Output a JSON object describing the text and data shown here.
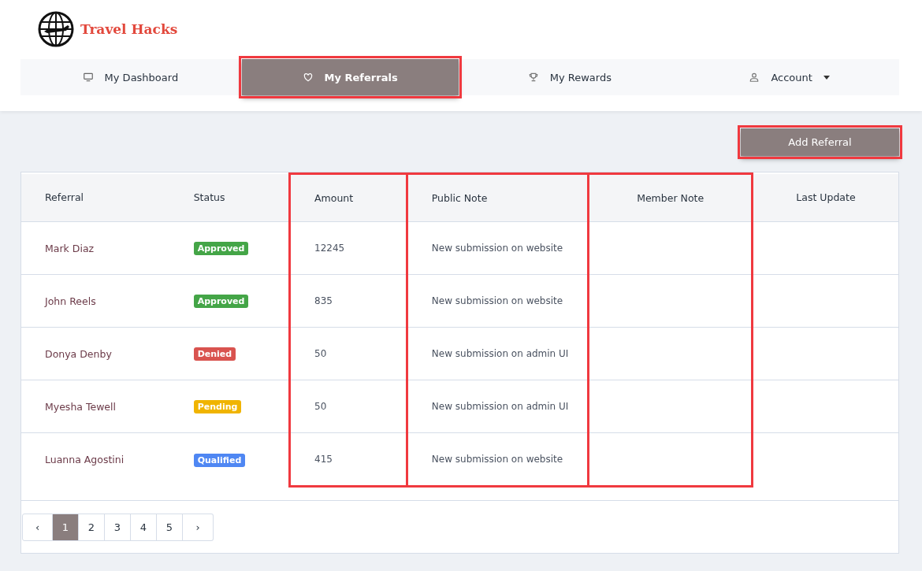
{
  "brand": {
    "name": "Travel Hacks"
  },
  "nav": [
    {
      "label": "My Dashboard",
      "selected": false,
      "highlighted": false
    },
    {
      "label": "My Referrals",
      "selected": true,
      "highlighted": true
    },
    {
      "label": "My Rewards",
      "selected": false,
      "highlighted": false
    },
    {
      "label": "Account",
      "selected": false,
      "highlighted": false,
      "dropdown": true
    }
  ],
  "add_button": {
    "label": "Add Referral",
    "highlighted": true
  },
  "table": {
    "columns": [
      {
        "label": "Referral",
        "highlighted": false
      },
      {
        "label": "Status",
        "highlighted": false
      },
      {
        "label": "Amount",
        "highlighted": true
      },
      {
        "label": "Public Note",
        "highlighted": true
      },
      {
        "label": "Member Note",
        "highlighted": true
      },
      {
        "label": "Last Update",
        "highlighted": false
      }
    ],
    "rows": [
      {
        "referral": "Mark Diaz",
        "status": "Approved",
        "color": "#44a547",
        "amount": "12245",
        "public_note": "New submission on website"
      },
      {
        "referral": "John Reels",
        "status": "Approved",
        "color": "#44a547",
        "amount": "835",
        "public_note": "New submission on website"
      },
      {
        "referral": "Donya Denby",
        "status": "Denied",
        "color": "#d9534f",
        "amount": "50",
        "public_note": "New submission on admin UI"
      },
      {
        "referral": "Myesha Tewell",
        "status": "Pending",
        "color": "#f0b400",
        "amount": "50",
        "public_note": "New submission on admin UI"
      },
      {
        "referral": "Luanna Agostini",
        "status": "Qualified",
        "color": "#4f87f3",
        "amount": "415",
        "public_note": "New submission on website"
      }
    ]
  },
  "pagination": {
    "prev": "‹",
    "next": "›",
    "pages": [
      {
        "label": "1",
        "selected": true
      },
      {
        "label": "2",
        "selected": false
      },
      {
        "label": "3",
        "selected": false
      },
      {
        "label": "4",
        "selected": false
      },
      {
        "label": "5",
        "selected": false
      }
    ]
  }
}
